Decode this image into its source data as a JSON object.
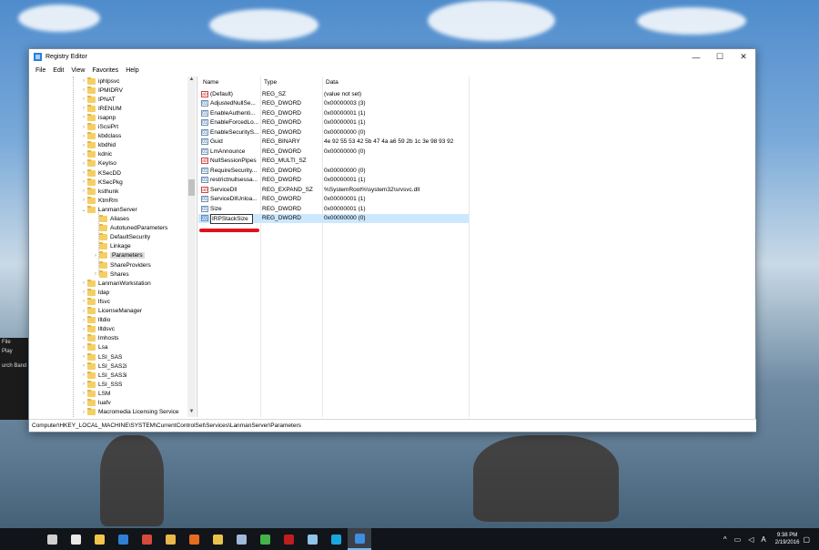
{
  "window": {
    "title": "Registry Editor",
    "controls": {
      "minimize": "—",
      "maximize": "☐",
      "close": "✕"
    }
  },
  "menu": [
    "File",
    "Edit",
    "View",
    "Favorites",
    "Help"
  ],
  "tree": {
    "items": [
      {
        "label": "iphlpsvc",
        "level": 0,
        "expander": true
      },
      {
        "label": "IPMIDRV",
        "level": 0,
        "expander": true
      },
      {
        "label": "IPNAT",
        "level": 0,
        "expander": true
      },
      {
        "label": "IRENUM",
        "level": 0,
        "expander": true
      },
      {
        "label": "isapnp",
        "level": 0,
        "expander": true
      },
      {
        "label": "iScsiPrt",
        "level": 0,
        "expander": true
      },
      {
        "label": "kbdclass",
        "level": 0,
        "expander": true
      },
      {
        "label": "kbdhid",
        "level": 0,
        "expander": true
      },
      {
        "label": "kdnic",
        "level": 0,
        "expander": true
      },
      {
        "label": "KeyIso",
        "level": 0,
        "expander": true
      },
      {
        "label": "KSecDD",
        "level": 0,
        "expander": true
      },
      {
        "label": "KSecPkg",
        "level": 0,
        "expander": true
      },
      {
        "label": "ksthunk",
        "level": 0,
        "expander": true
      },
      {
        "label": "KtmRm",
        "level": 0,
        "expander": true
      },
      {
        "label": "LanmanServer",
        "level": 0,
        "expander": true,
        "expanded": true
      },
      {
        "label": "Aliases",
        "level": 1,
        "expander": false
      },
      {
        "label": "AutotunedParameters",
        "level": 1,
        "expander": false
      },
      {
        "label": "DefaultSecurity",
        "level": 1,
        "expander": false
      },
      {
        "label": "Linkage",
        "level": 1,
        "expander": false
      },
      {
        "label": "Parameters",
        "level": 1,
        "expander": true,
        "selected": true
      },
      {
        "label": "ShareProviders",
        "level": 1,
        "expander": false
      },
      {
        "label": "Shares",
        "level": 1,
        "expander": true
      },
      {
        "label": "LanmanWorkstation",
        "level": 0,
        "expander": true
      },
      {
        "label": "ldap",
        "level": 0,
        "expander": true
      },
      {
        "label": "lfsvc",
        "level": 0,
        "expander": true
      },
      {
        "label": "LicenseManager",
        "level": 0,
        "expander": true
      },
      {
        "label": "lltdio",
        "level": 0,
        "expander": true
      },
      {
        "label": "lltdsvc",
        "level": 0,
        "expander": true
      },
      {
        "label": "lmhosts",
        "level": 0,
        "expander": true
      },
      {
        "label": "Lsa",
        "level": 0,
        "expander": true
      },
      {
        "label": "LSI_SAS",
        "level": 0,
        "expander": true
      },
      {
        "label": "LSI_SAS2i",
        "level": 0,
        "expander": true
      },
      {
        "label": "LSI_SAS3i",
        "level": 0,
        "expander": true
      },
      {
        "label": "LSI_SSS",
        "level": 0,
        "expander": true
      },
      {
        "label": "LSM",
        "level": 0,
        "expander": true
      },
      {
        "label": "luafv",
        "level": 0,
        "expander": true
      },
      {
        "label": "Macromedia Licensing Service",
        "level": 0,
        "expander": true
      }
    ]
  },
  "list": {
    "headers": {
      "name": "Name",
      "type": "Type",
      "data": "Data"
    },
    "rows": [
      {
        "name": "(Default)",
        "type": "REG_SZ",
        "data": "(value not set)",
        "kind": "str"
      },
      {
        "name": "AdjustedNullSe...",
        "type": "REG_DWORD",
        "data": "0x00000003 (3)",
        "kind": "bin"
      },
      {
        "name": "EnableAuthenti...",
        "type": "REG_DWORD",
        "data": "0x00000001 (1)",
        "kind": "bin"
      },
      {
        "name": "EnableForcedLo...",
        "type": "REG_DWORD",
        "data": "0x00000001 (1)",
        "kind": "bin"
      },
      {
        "name": "EnableSecurityS...",
        "type": "REG_DWORD",
        "data": "0x00000000 (0)",
        "kind": "bin"
      },
      {
        "name": "Guid",
        "type": "REG_BINARY",
        "data": "4e 92 55 53 42 5b 47 4a a6 59 2b 1c 3e 98 93 92",
        "kind": "bin"
      },
      {
        "name": "LmAnnounce",
        "type": "REG_DWORD",
        "data": "0x00000000 (0)",
        "kind": "bin"
      },
      {
        "name": "NullSessionPipes",
        "type": "REG_MULTI_SZ",
        "data": "",
        "kind": "str"
      },
      {
        "name": "RequireSecurity...",
        "type": "REG_DWORD",
        "data": "0x00000000 (0)",
        "kind": "bin"
      },
      {
        "name": "restrictnullsessa...",
        "type": "REG_DWORD",
        "data": "0x00000001 (1)",
        "kind": "bin"
      },
      {
        "name": "ServiceDll",
        "type": "REG_EXPAND_SZ",
        "data": "%SystemRoot%\\system32\\srvsvc.dll",
        "kind": "str"
      },
      {
        "name": "ServiceDllUnloa...",
        "type": "REG_DWORD",
        "data": "0x00000001 (1)",
        "kind": "bin"
      },
      {
        "name": "Size",
        "type": "REG_DWORD",
        "data": "0x00000001 (1)",
        "kind": "bin"
      },
      {
        "name": "IRPStackSize",
        "type": "REG_DWORD",
        "data": "0x00000000 (0)",
        "kind": "bin",
        "editing": true
      }
    ]
  },
  "status": {
    "path": "Computer\\HKEY_LOCAL_MACHINE\\SYSTEM\\CurrentControlSet\\Services\\LanmanServer\\Parameters"
  },
  "background_app": {
    "menu_file": "File",
    "menu_play": "Play",
    "track": "urch Band -"
  },
  "taskbar": {
    "icons": [
      {
        "name": "task-view-icon",
        "color": "#cfcfcf"
      },
      {
        "name": "store-icon",
        "color": "#e9e9e9"
      },
      {
        "name": "file-explorer-icon",
        "color": "#f2c649"
      },
      {
        "name": "edge-icon",
        "color": "#2f7fd3"
      },
      {
        "name": "chrome-icon",
        "color": "#d64a3b"
      },
      {
        "name": "folder-icon",
        "color": "#e8b84b"
      },
      {
        "name": "firefox-icon",
        "color": "#e66d1f"
      },
      {
        "name": "winamp-icon",
        "color": "#e9c24c"
      },
      {
        "name": "app-icon",
        "color": "#9fb9d9"
      },
      {
        "name": "green-app-icon",
        "color": "#45b349"
      },
      {
        "name": "filezilla-icon",
        "color": "#bf1e1e"
      },
      {
        "name": "notepad-icon",
        "color": "#8fc3e8"
      },
      {
        "name": "skype-icon",
        "color": "#19a7e0"
      },
      {
        "name": "regedit-icon",
        "color": "#3d8ee0"
      }
    ],
    "tray": {
      "chevron": "^",
      "network": "▭",
      "volume": "◁",
      "ime": "A",
      "notifications": "▢"
    },
    "clock": {
      "time": "9:38 PM",
      "date": "2/19/2016"
    }
  }
}
